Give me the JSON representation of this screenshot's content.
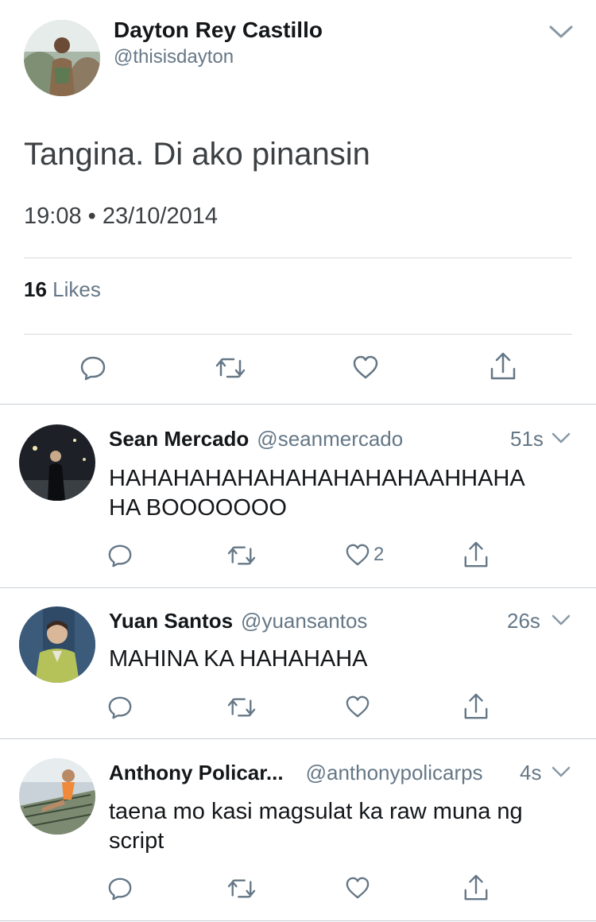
{
  "tweet": {
    "author_name": "Dayton Rey Castillo",
    "author_handle": "@thisisdayton",
    "text": "Tangina. Di ako pinansin",
    "time": "19:08",
    "date": "23/10/2014",
    "time_sep": "•",
    "likes_count": "16",
    "likes_label": "Likes"
  },
  "replies": [
    {
      "name": "Sean Mercado",
      "handle": "@seanmercado",
      "time": "51s",
      "text_line1": "HAHAHAHAHAHAHAHAHAHAAHHAHA",
      "text_line2": "HA BOOOOOOO",
      "like_count": "2"
    },
    {
      "name": "Yuan Santos",
      "handle": "@yuansantos",
      "time": "26s",
      "text_line1": "MAHINA KA HAHAHAHA",
      "text_line2": "",
      "like_count": ""
    },
    {
      "name": "Anthony Policar...",
      "handle": "@anthonypolicarps",
      "time": "4s",
      "text_line1": "taena mo kasi magsulat ka raw muna ng",
      "text_line2": "script",
      "like_count": ""
    }
  ],
  "icons": {
    "reply": "reply-icon",
    "retweet": "retweet-icon",
    "like": "heart-icon",
    "share": "share-icon",
    "chevron": "chevron-down-icon"
  },
  "colors": {
    "text": "#14171a",
    "secondary": "#657786",
    "icon": "#657786",
    "divider": "#d6dadd"
  }
}
